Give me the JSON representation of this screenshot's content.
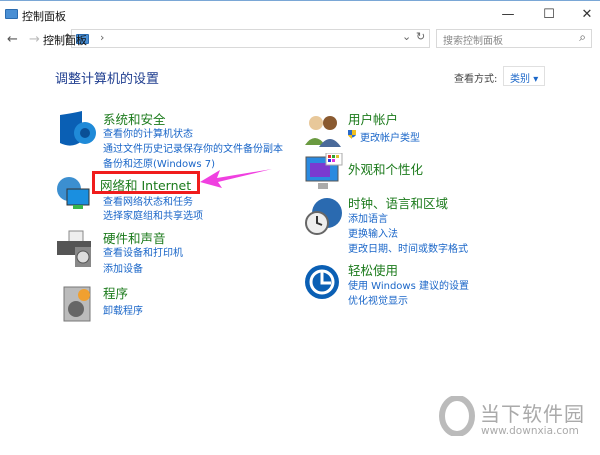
{
  "window": {
    "title": "控制面板",
    "minimize": "—",
    "maximize": "☐",
    "close": "✕"
  },
  "nav": {
    "back": "←",
    "forward": "→",
    "recent": "⌄",
    "up": "↑",
    "sep": "›",
    "path": "控制面板",
    "dropdown": "⌄",
    "refresh": "↻"
  },
  "search": {
    "placeholder": "搜索控制面板",
    "icon": "⌕"
  },
  "main": {
    "heading": "调整计算机的设置",
    "view_label": "查看方式:",
    "view_value": "类别",
    "view_caret": "▾"
  },
  "left": [
    {
      "title": "系统和安全",
      "icon": "shield-icon",
      "links": [
        "查看你的计算机状态",
        "通过文件历史记录保存你的文件备份副本",
        "备份和还原(Windows 7)"
      ]
    },
    {
      "title": "网络和 Internet",
      "icon": "network-icon",
      "links": [
        "查看网络状态和任务",
        "选择家庭组和共享选项"
      ]
    },
    {
      "title": "硬件和声音",
      "icon": "printer-icon",
      "links": [
        "查看设备和打印机",
        "添加设备"
      ]
    },
    {
      "title": "程序",
      "icon": "programs-icon",
      "links": [
        "卸载程序"
      ]
    }
  ],
  "right": [
    {
      "title": "用户帐户",
      "icon": "users-icon",
      "links": [
        "更改帐户类型"
      ]
    },
    {
      "title": "外观和个性化",
      "icon": "monitor-icon",
      "links": []
    },
    {
      "title": "时钟、语言和区域",
      "icon": "clock-globe-icon",
      "links": [
        "添加语言",
        "更换输入法",
        "更改日期、时间或数字格式"
      ]
    },
    {
      "title": "轻松使用",
      "icon": "ease-of-access-icon",
      "links": [
        "使用 Windows 建议的设置",
        "优化视觉显示"
      ]
    }
  ],
  "watermark": {
    "name": "当下软件园",
    "url": "www.downxia.com"
  },
  "colors": {
    "highlight": "#f01c1c",
    "arrow": "#f040e0",
    "link": "#1a66c8",
    "category": "#1b7a1b"
  }
}
